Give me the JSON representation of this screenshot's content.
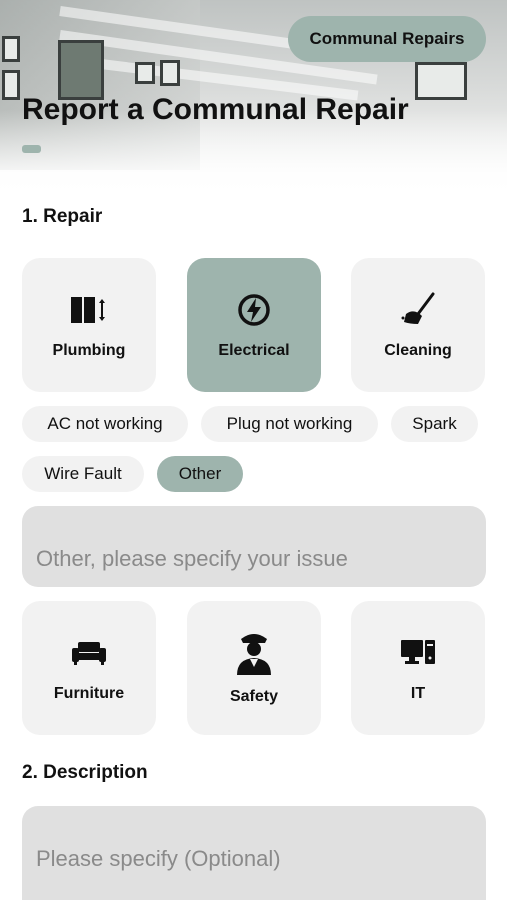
{
  "header": {
    "section_badge": "Communal Repairs",
    "page_title": "Report a Communal Repair"
  },
  "repair": {
    "section_title": "1. Repair",
    "categories": [
      {
        "label": "Plumbing",
        "icon": "plumbing-icon",
        "selected": false
      },
      {
        "label": "Electrical",
        "icon": "electrical-icon",
        "selected": true
      },
      {
        "label": "Cleaning",
        "icon": "cleaning-icon",
        "selected": false
      },
      {
        "label": "Furniture",
        "icon": "sofa-icon",
        "selected": false
      },
      {
        "label": "Safety",
        "icon": "security-guard-icon",
        "selected": false
      },
      {
        "label": "IT",
        "icon": "computer-icon",
        "selected": false
      }
    ],
    "issues": [
      {
        "label": "AC not working",
        "selected": false
      },
      {
        "label": "Plug not working",
        "selected": false
      },
      {
        "label": "Spark",
        "selected": false
      },
      {
        "label": "Wire Fault",
        "selected": false
      },
      {
        "label": "Other",
        "selected": true
      }
    ],
    "other_placeholder": "Other, please specify your issue"
  },
  "description": {
    "section_title": "2. Description",
    "placeholder": "Please specify (Optional)"
  },
  "colors": {
    "accent": "#9eb4ad",
    "card_bg": "#f2f2f2",
    "input_bg": "#e0e0e0",
    "placeholder_text": "#8a8a8a"
  }
}
